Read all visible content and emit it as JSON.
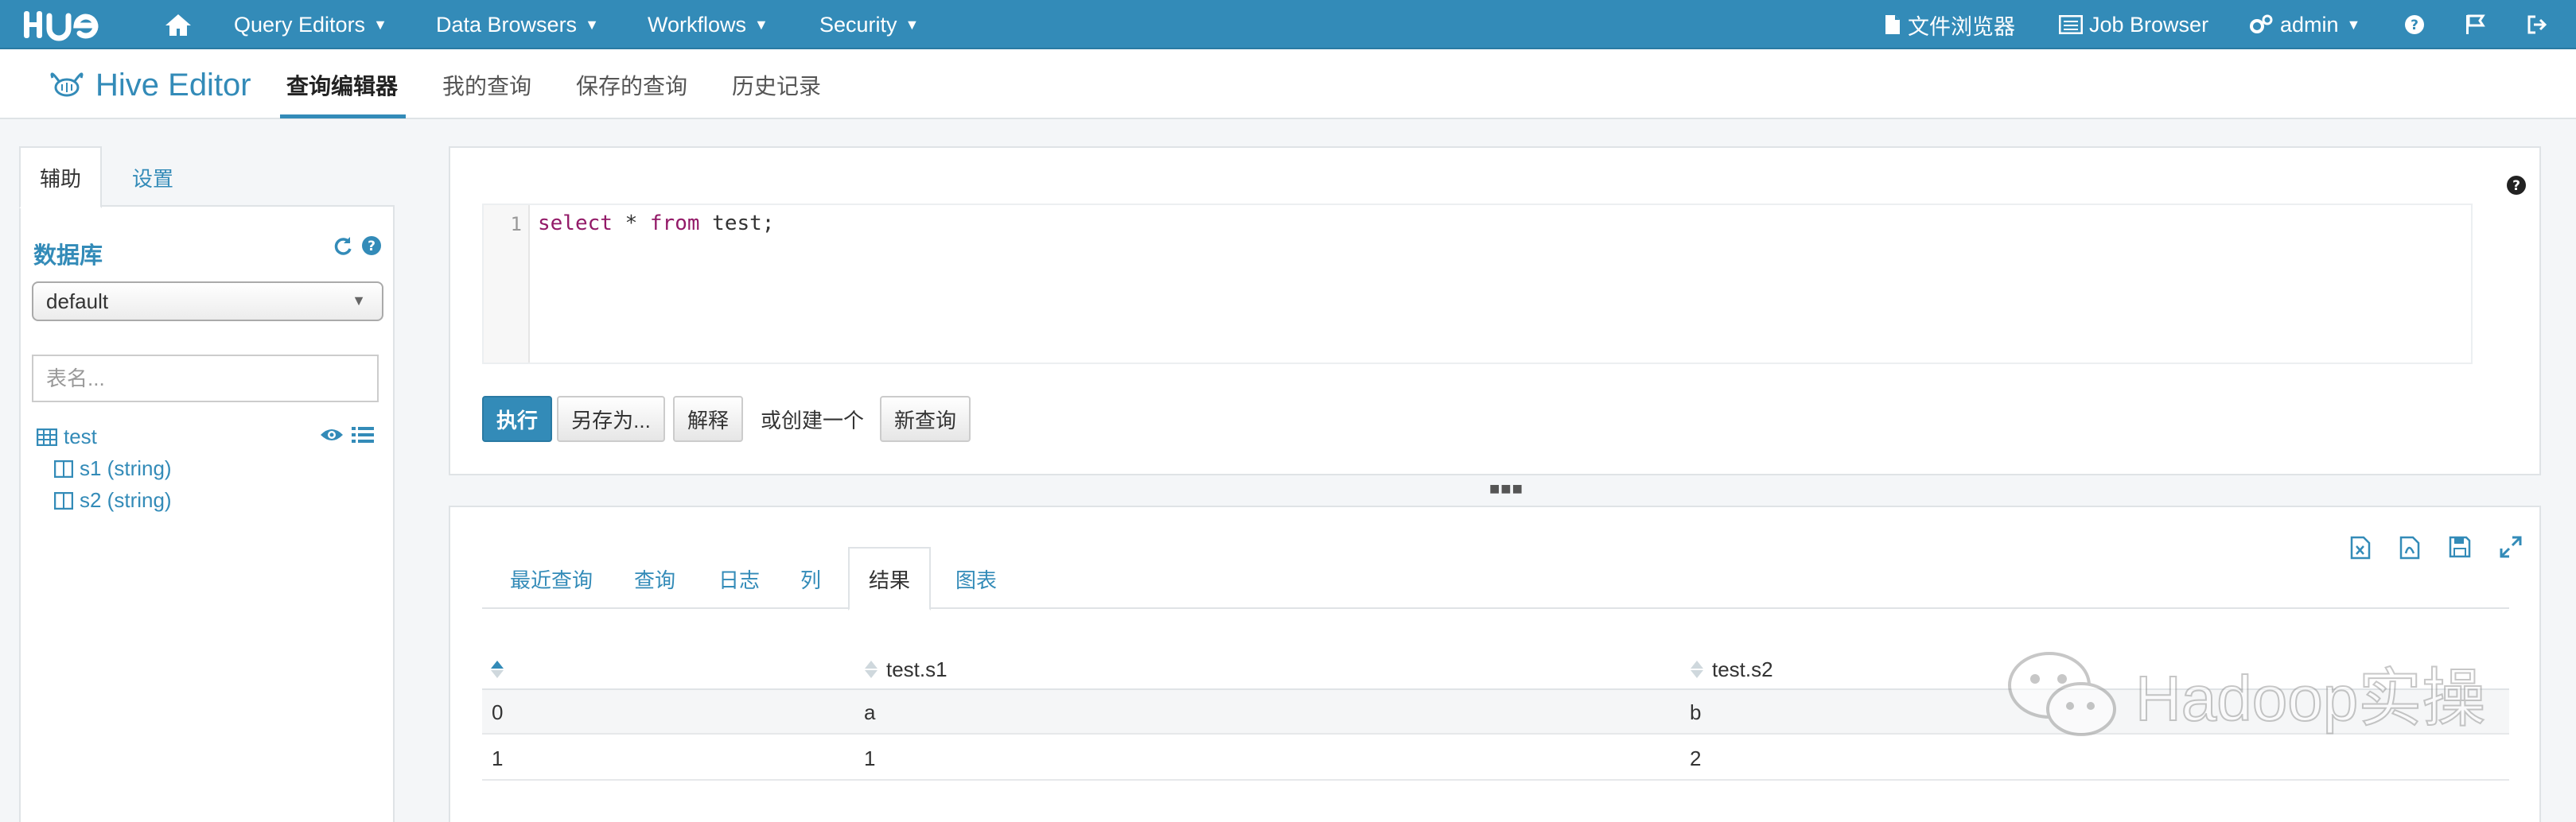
{
  "topnav": {
    "logo": "HUE",
    "items": [
      {
        "label": "Query Editors"
      },
      {
        "label": "Data Browsers"
      },
      {
        "label": "Workflows"
      },
      {
        "label": "Security"
      }
    ],
    "right": {
      "file_browser": "文件浏览器",
      "job_browser": "Job Browser",
      "user": "admin"
    }
  },
  "subbar": {
    "app_title": "Hive Editor",
    "tabs": [
      {
        "label": "查询编辑器",
        "active": true
      },
      {
        "label": "我的查询"
      },
      {
        "label": "保存的查询"
      },
      {
        "label": "历史记录"
      }
    ]
  },
  "left": {
    "tabs": [
      {
        "label": "辅助",
        "active": true
      },
      {
        "label": "设置"
      }
    ],
    "db_label": "数据库",
    "db_selected": "default",
    "table_search_placeholder": "表名...",
    "tree": [
      {
        "name": "test",
        "type": "table"
      },
      {
        "name": "s1 (string)",
        "type": "column"
      },
      {
        "name": "s2 (string)",
        "type": "column"
      }
    ]
  },
  "editor": {
    "line_number": "1",
    "code": {
      "kw1": "select",
      "mid": " * ",
      "kw2": "from",
      "rest": " test;"
    },
    "buttons": {
      "execute": "执行",
      "save_as": "另存为...",
      "explain": "解释",
      "or_create": "或创建一个",
      "new_query": "新查询"
    }
  },
  "results": {
    "tabs": [
      {
        "label": "最近查询"
      },
      {
        "label": "查询"
      },
      {
        "label": "日志"
      },
      {
        "label": "列"
      },
      {
        "label": "结果",
        "active": true
      },
      {
        "label": "图表"
      }
    ],
    "columns": [
      "",
      "test.s1",
      "test.s2"
    ],
    "rows": [
      [
        "0",
        "a",
        "b"
      ],
      [
        "1",
        "1",
        "2"
      ]
    ]
  },
  "watermark": "Hadoop实操",
  "colors": {
    "brand": "#338bb8",
    "keyword": "#931a68",
    "border": "#dfe3e6"
  }
}
